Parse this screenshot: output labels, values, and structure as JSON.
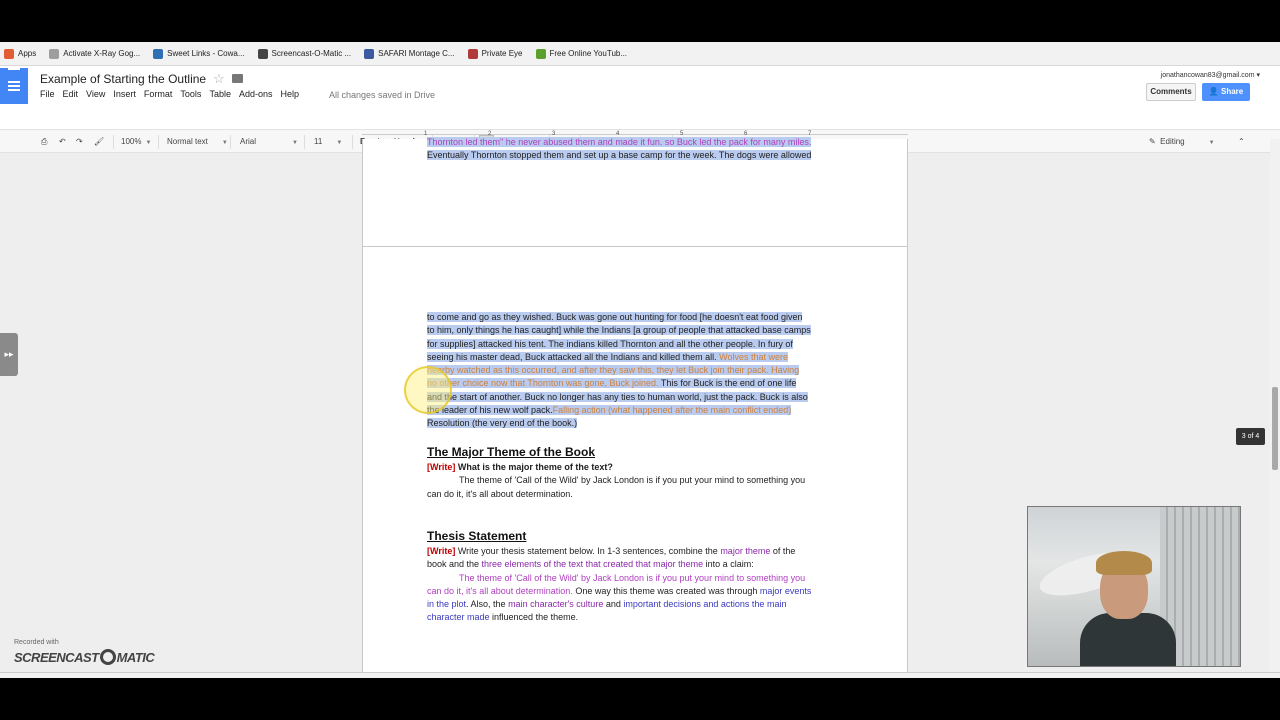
{
  "bookmarks": [
    {
      "label": "Apps",
      "icon": "apps-grid-icon",
      "color": "#e25d33"
    },
    {
      "label": "Activate X-Ray Gog...",
      "icon": "page-icon",
      "color": "#9e9e9e"
    },
    {
      "label": "Sweet Links - Cowa...",
      "icon": "weebly-icon",
      "color": "#2f6fb3"
    },
    {
      "label": "Screencast-O-Matic ...",
      "icon": "screencast-icon",
      "color": "#444444"
    },
    {
      "label": "SAFARI Montage C...",
      "icon": "safari-montage-icon",
      "color": "#3a5ba0"
    },
    {
      "label": "Private Eye",
      "icon": "eye-icon",
      "color": "#b03a3a"
    },
    {
      "label": "Free Online YouTub...",
      "icon": "leaf-icon",
      "color": "#5aa02c"
    }
  ],
  "doc": {
    "title": "Example of Starting the Outline",
    "menus": [
      "File",
      "Edit",
      "View",
      "Insert",
      "Format",
      "Tools",
      "Table",
      "Add-ons",
      "Help"
    ],
    "saved_status": "All changes saved in Drive",
    "account": "jonathancowan83@gmail.com",
    "comments": "Comments",
    "share": "Share"
  },
  "toolbar": {
    "zoom": "100%",
    "style": "Normal text",
    "font": "Arial",
    "size": "11",
    "bold": "B",
    "italic": "I",
    "underline": "U",
    "text_color": "A",
    "mode": "Editing"
  },
  "ruler": [
    "1",
    "2",
    "3",
    "4",
    "5",
    "6",
    "7"
  ],
  "page1": {
    "line1": "Thornton led them\" he never abused them and made it fun. so Buck led the pack for many miles.",
    "line2": "Eventually Thornton stopped them and set up a base camp for the week. The dogs were allowed"
  },
  "page2": {
    "para": [
      {
        "t": "to come and go as they wished. Buck was gone out hunting for food [he doesn't eat food given",
        "c": ""
      },
      {
        "t": "to him, only things he has caught] while the Indians [a group of people that attacked base camps",
        "c": ""
      },
      {
        "t": "for supplies]  attacked his tent. The indians killed Thornton and all the other people. In fury of",
        "c": ""
      },
      {
        "t": "seeing his master dead, Buck attacked all the Indians and killed them all. ",
        "c": "",
        "t2": "Wolves that were",
        "c2": "org"
      },
      {
        "t": "nearby watched as this occurred, and after they saw this, they let Buck join their pack. Having",
        "c": "org"
      },
      {
        "t": "no other choice now that Thornton was gone, Buck joined.",
        "c": "org",
        "t2": " This for Buck is the end of one life",
        "c2": ""
      },
      {
        "t": "and the start of another. Buck no longer has any ties to human world, just the pack. Buck is also",
        "c": ""
      },
      {
        "t": "the leader of his new wolf pack.",
        "c": "",
        "t2": "Falling action (what happened after the main conflict ended)",
        "c2": "org"
      },
      {
        "t": "Resolution (the very end of the book.)",
        "c": ""
      }
    ],
    "theme_heading": "The Major Theme of the Book",
    "theme_write": "[Write]",
    "theme_question": " What is the major theme of the text?",
    "theme_answer1": "The theme of 'Call of the Wild' by Jack London is if you put your mind to something you",
    "theme_answer2": "can do it, it's all about determination.",
    "thesis_heading": "Thesis Statement",
    "thesis_write": "[Write]",
    "thesis_p1a": "  Write your thesis statement below. In 1-3 sentences, combine the ",
    "thesis_p1b": "major theme",
    "thesis_p1c": " of the",
    "thesis_p2a": "book and the ",
    "thesis_p2b": "three elements of the text that created that major theme",
    "thesis_p2c": " into a claim:",
    "thesis_p3": "The theme of 'Call of the Wild' by Jack London is if you put your mind to something you",
    "thesis_p4a": "can do it, it's all about determination.",
    "thesis_p4b": " One way this theme was created was through ",
    "thesis_p4c": "major events",
    "thesis_p5a": "in the plot",
    "thesis_p5b": ". Also, the ",
    "thesis_p5c": "main character's culture",
    "thesis_p5d": " and ",
    "thesis_p5e": "important decisions and actions the main",
    "thesis_p6a": "character made",
    "thesis_p6b": " influenced the theme."
  },
  "page_indicator": "3 of 4",
  "screencast": {
    "recorded": "Recorded with",
    "logo_left": "SCREENCAST",
    "logo_right": "MATIC"
  },
  "colors": {
    "selection": "#b9cbee",
    "share_blue": "#4d90fe",
    "docs_blue": "#4285f4",
    "magenta": "#b040c0",
    "orange": "#d0803a",
    "write_red": "#c00000"
  }
}
